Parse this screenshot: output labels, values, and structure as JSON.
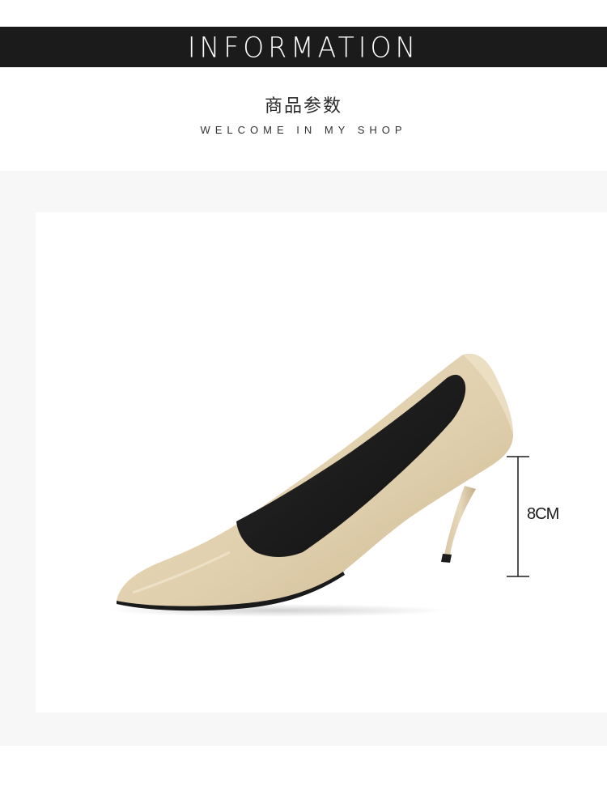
{
  "header": {
    "title": "INFORMATION",
    "subtitle_cn": "商品参数",
    "subtitle_en": "WELCOME IN MY SHOP"
  },
  "product": {
    "heel_height_label": "8CM",
    "shoe_color": "#e2d2b2",
    "lining_color": "#1a1a1a"
  },
  "colors": {
    "banner_bg": "#1b1b1b",
    "banner_text": "#ffffff",
    "photo_backdrop": "#f7f7f7"
  }
}
